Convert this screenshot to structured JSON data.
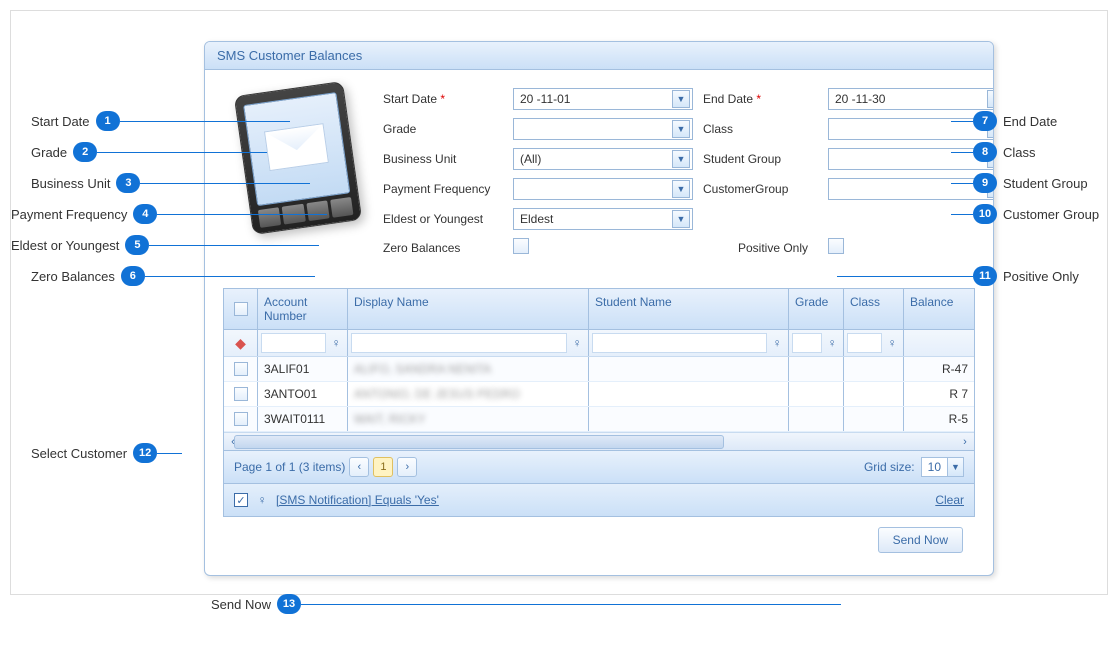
{
  "panel": {
    "title": "SMS Customer Balances"
  },
  "form": {
    "start_date": {
      "label": "Start Date",
      "value": "20  -11-01",
      "required": "*"
    },
    "end_date": {
      "label": "End Date",
      "value": "20  -11-30",
      "required": "*"
    },
    "grade": {
      "label": "Grade",
      "value": ""
    },
    "class": {
      "label": "Class",
      "value": ""
    },
    "business_unit": {
      "label": "Business Unit",
      "value": "(All)"
    },
    "student_group": {
      "label": "Student Group",
      "value": ""
    },
    "payment_freq": {
      "label": "Payment Frequency",
      "value": ""
    },
    "customer_group": {
      "label": "CustomerGroup",
      "value": ""
    },
    "eldest_youngest": {
      "label": "Eldest or Youngest",
      "value": "Eldest"
    },
    "zero_balances": {
      "label": "Zero Balances"
    },
    "positive_only": {
      "label": "Positive Only"
    }
  },
  "callouts": {
    "left": [
      {
        "n": "1",
        "text": "Start Date"
      },
      {
        "n": "2",
        "text": "Grade"
      },
      {
        "n": "3",
        "text": "Business Unit"
      },
      {
        "n": "4",
        "text": "Payment Frequency"
      },
      {
        "n": "5",
        "text": "Eldest or Youngest"
      },
      {
        "n": "6",
        "text": "Zero Balances"
      },
      {
        "n": "12",
        "text": "Select Customer"
      },
      {
        "n": "13",
        "text": "Send Now"
      }
    ],
    "right": [
      {
        "n": "7",
        "text": "End Date"
      },
      {
        "n": "8",
        "text": "Class"
      },
      {
        "n": "9",
        "text": "Student Group"
      },
      {
        "n": "10",
        "text": "Customer Group"
      },
      {
        "n": "11",
        "text": "Positive Only"
      }
    ]
  },
  "grid": {
    "headers": {
      "account": "Account Number",
      "display_name": "Display Name",
      "student_name": "Student Name",
      "grade": "Grade",
      "class": "Class",
      "balance": "Balance"
    },
    "rows": [
      {
        "account": "3ALIF01",
        "display_name": "ALIFO, SANDRA NENITA",
        "student_name": "",
        "grade": "",
        "class": "",
        "balance": "R-47"
      },
      {
        "account": "3ANTO01",
        "display_name": "ANTONIO, DE JESUS PEDRO",
        "student_name": "",
        "grade": "",
        "class": "",
        "balance": "R 7"
      },
      {
        "account": "3WAIT0111",
        "display_name": "WAIT, RICKY",
        "student_name": "",
        "grade": "",
        "class": "",
        "balance": "R-5"
      }
    ],
    "pager": {
      "text": "Page 1 of 1 (3 items)",
      "current": "1",
      "grid_size_label": "Grid size:",
      "grid_size": "10"
    },
    "filterbar": {
      "text": "[SMS Notification] Equals 'Yes'",
      "clear": "Clear"
    }
  },
  "footer": {
    "send_now": "Send Now",
    "send_now_label": "Send Now"
  }
}
